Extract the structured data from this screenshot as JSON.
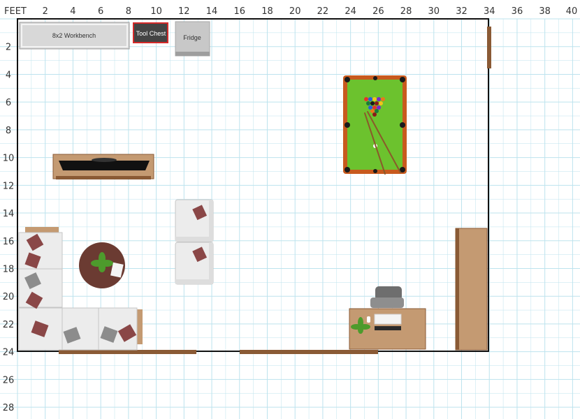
{
  "plan": {
    "unit_label": "FEET",
    "x_ticks": [
      "2",
      "4",
      "6",
      "8",
      "10",
      "12",
      "14",
      "16",
      "18",
      "20",
      "22",
      "24",
      "26",
      "28",
      "30",
      "32",
      "34",
      "36",
      "38",
      "40"
    ],
    "y_ticks": [
      "2",
      "4",
      "6",
      "8",
      "10",
      "12",
      "14",
      "16",
      "18",
      "20",
      "22",
      "24",
      "26",
      "28"
    ]
  },
  "items": {
    "workbench": "8x2 Workbench",
    "tool_chest": "Tool Chest",
    "fridge": "Fridge"
  },
  "colors": {
    "grid": "#bde3ee",
    "wall": "#111111",
    "wood": "#c49a72",
    "wood_dark": "#8a5a35",
    "felt": "#6cc22e",
    "rail": "#c85a1e",
    "sofa": "#ececec",
    "pillow_red": "#8a4747",
    "pillow_gray": "#8c8c8c",
    "workbench": "#d8d8d8",
    "tool_chest": "#444444",
    "tool_chest_border": "#d42a2a",
    "fridge": "#c8c8c8",
    "coffee_table": "#6b3b32",
    "plant": "#4d9b2c"
  }
}
